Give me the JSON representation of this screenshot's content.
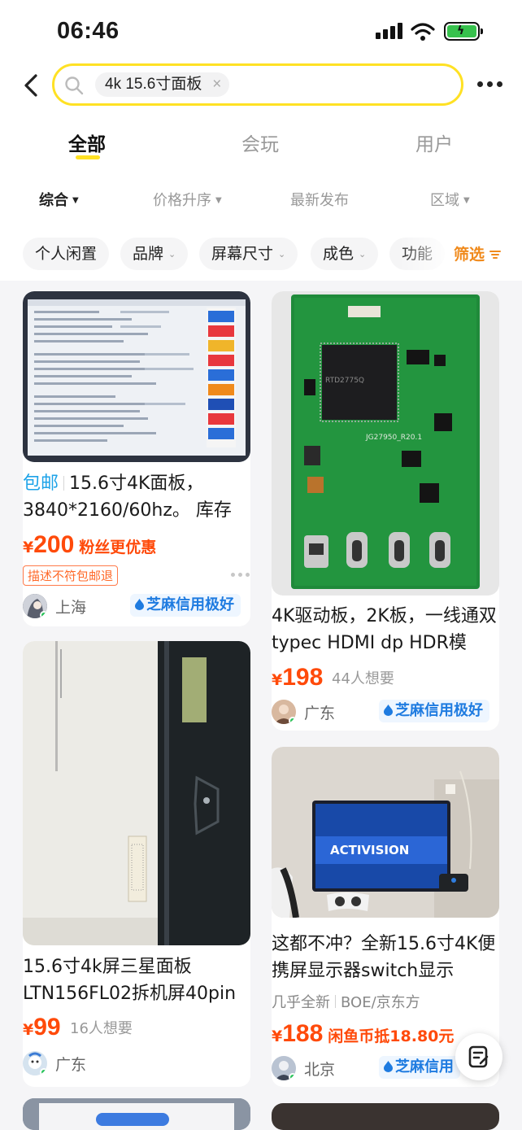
{
  "status": {
    "time": "06:46"
  },
  "search": {
    "query": "4k 15.6寸面板",
    "clear_icon": "×"
  },
  "tabs": [
    {
      "label": "全部",
      "active": true
    },
    {
      "label": "会玩"
    },
    {
      "label": "用户"
    }
  ],
  "sorts": [
    {
      "label": "综合",
      "active": true
    },
    {
      "label": "价格升序"
    },
    {
      "label": "最新发布"
    },
    {
      "label": "区域"
    }
  ],
  "chips": [
    "个人闲置",
    "品牌",
    "屏幕尺寸",
    "成色",
    "功能"
  ],
  "filter_label": "筛选",
  "items": [
    {
      "tag": "包邮",
      "title": "15.6寸4K面板，3840*2160/60hz。 库存",
      "price_symbol": "¥",
      "price": "200",
      "price_sub": "粉丝更优惠",
      "badge": "描述不符包邮退",
      "location": "上海",
      "credit": "芝麻信用极好"
    },
    {
      "title": "4K驱动板，2K板，一线通双typec HDMI dp HDR模",
      "price_symbol": "¥",
      "price": "198",
      "want": "44人想要",
      "location": "广东",
      "credit": "芝麻信用极好"
    },
    {
      "title": "15.6寸4k屏三星面板LTN156FL02拆机屏40pin",
      "price_symbol": "¥",
      "price": "99",
      "want": "16人想要",
      "location": "广东"
    },
    {
      "title": "这都不冲？全新15.6寸4K便携屏显示器switch显示",
      "tags": [
        "几乎全新",
        "BOE/京东方"
      ],
      "price_symbol": "¥",
      "price": "188",
      "price_sub": "闲鱼币抵18.80元",
      "location": "北京",
      "credit": "芝麻信用"
    }
  ],
  "colors": {
    "accent": "#ffe124",
    "price": "#ff4a0a",
    "credit": "#1e7be0",
    "filter": "#f08a1c"
  }
}
